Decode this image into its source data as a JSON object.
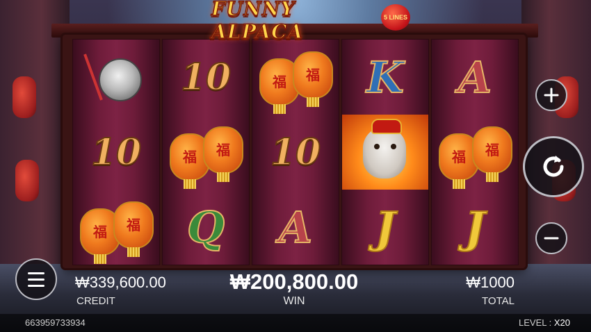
{
  "game": {
    "title": "FUNNY ALPACA",
    "lines_badge": "5 LINES"
  },
  "reels": [
    [
      "gong",
      "10",
      "lantern"
    ],
    [
      "10",
      "lantern",
      "Q"
    ],
    [
      "lantern",
      "10",
      "A"
    ],
    [
      "K",
      "alpaca",
      "J"
    ],
    [
      "A",
      "lantern",
      "J"
    ]
  ],
  "symbols": {
    "lantern_char": "福"
  },
  "controls": {
    "bet_up_icon": "plus-icon",
    "bet_down_icon": "minus-icon",
    "spin_icon": "spin-refresh-icon",
    "menu_icon": "hamburger-menu-icon"
  },
  "info": {
    "credit_value": "₩339,600.00",
    "credit_label": "CREDIT",
    "win_value": "₩200,800.00",
    "win_label": "WIN",
    "total_value": "₩1000",
    "total_label": "TOTAL"
  },
  "footer": {
    "session_id": "663959733934",
    "level_label": "LEVEL :",
    "level_value": "X20"
  },
  "colors": {
    "gold": "#ffd44a",
    "reel_maroon": "#6e1c3a",
    "button_border": "#bdbdc4"
  }
}
